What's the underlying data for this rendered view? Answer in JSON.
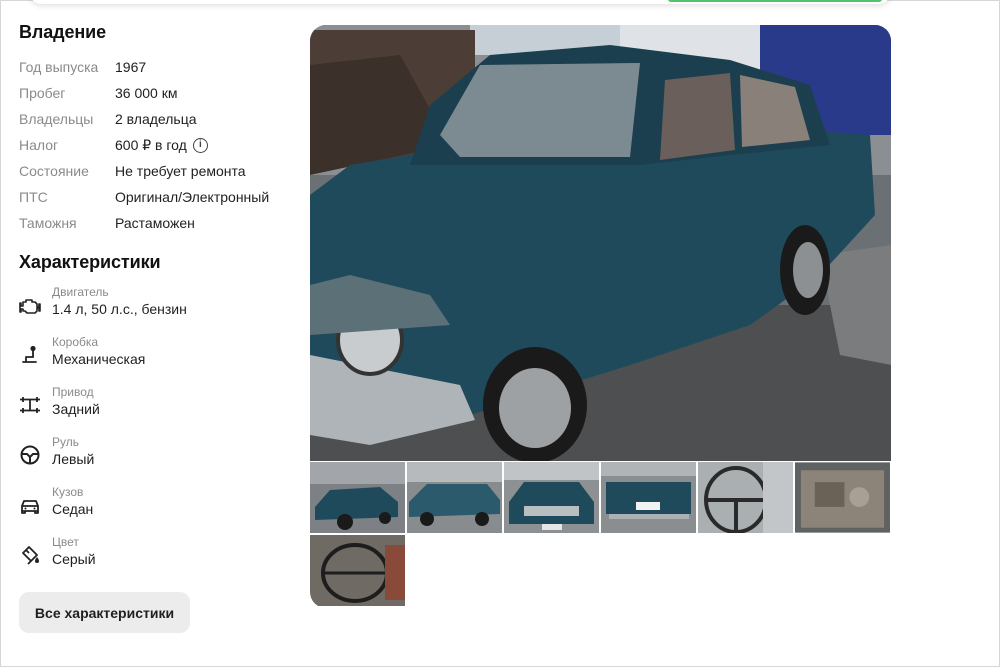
{
  "ownership": {
    "title": "Владение",
    "rows": [
      {
        "key": "Год выпуска",
        "value": "1967"
      },
      {
        "key": "Пробег",
        "value": "36 000 км"
      },
      {
        "key": "Владельцы",
        "value": "2 владельца"
      },
      {
        "key": "Налог",
        "value": "600 ₽ в год"
      },
      {
        "key": "Состояние",
        "value": "Не требует ремонта"
      },
      {
        "key": "ПТС",
        "value": "Оригинал/Электронный"
      },
      {
        "key": "Таможня",
        "value": "Растаможен"
      }
    ],
    "info_icon": "i"
  },
  "specs": {
    "title": "Характеристики",
    "items": [
      {
        "label": "Двигатель",
        "value": "1.4 л, 50 л.с., бензин",
        "icon": "engine-icon"
      },
      {
        "label": "Коробка",
        "value": "Механическая",
        "icon": "gearbox-icon"
      },
      {
        "label": "Привод",
        "value": "Задний",
        "icon": "drivetrain-icon"
      },
      {
        "label": "Руль",
        "value": "Левый",
        "icon": "steering-wheel-icon"
      },
      {
        "label": "Кузов",
        "value": "Седан",
        "icon": "car-body-icon"
      },
      {
        "label": "Цвет",
        "value": "Серый",
        "icon": "paint-icon"
      }
    ],
    "all_button": "Все характеристики"
  },
  "gallery": {
    "thumbnails": [
      "front-left view",
      "side view",
      "front view",
      "rear view",
      "steering wheel",
      "engine bay",
      "interior"
    ]
  },
  "colors": {
    "accent": "#54c26b",
    "car_body": "#1f4a5c"
  }
}
